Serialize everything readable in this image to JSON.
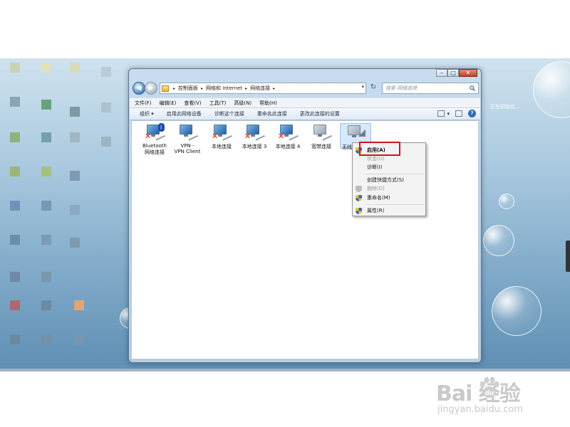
{
  "window": {
    "controls": {
      "minimize": "–",
      "maximize": "□",
      "close": "✕"
    }
  },
  "address": {
    "back_icon": "left-arrow-icon",
    "forward_icon": "right-arrow-icon",
    "crumbs": [
      "控制面板",
      "网络和 Internet",
      "网络连接"
    ],
    "search_placeholder": "搜索 网络连接",
    "refresh_glyph": "↻"
  },
  "menu": [
    "文件(F)",
    "编辑(E)",
    "查看(V)",
    "工具(T)",
    "高级(N)",
    "帮助(H)"
  ],
  "toolbar": {
    "organize": "组织 ▾",
    "enable_device": "启用此网络设备",
    "diagnose": "诊断这个连接",
    "rename": "重命名此连接",
    "change_settings": "更改此连接的设置",
    "help": "?"
  },
  "connections": [
    {
      "line1": "Bluetooth",
      "line2": "网络连接",
      "disabled": true,
      "badge": "bluetooth"
    },
    {
      "line1": "VPN -",
      "line2": "VPN Client",
      "disabled": false,
      "badge": ""
    },
    {
      "line1": "本地连接",
      "line2": "",
      "disabled": true,
      "badge": ""
    },
    {
      "line1": "本地连接 3",
      "line2": "",
      "disabled": true,
      "badge": ""
    },
    {
      "line1": "本地连接 4",
      "line2": "",
      "disabled": true,
      "badge": ""
    },
    {
      "line1": "宽带连接",
      "line2": "",
      "disabled": false,
      "badge": "grey"
    },
    {
      "line1": "无线",
      "line2": "",
      "disabled": false,
      "badge": "wireless",
      "selected": true
    }
  ],
  "context_menu": [
    {
      "label": "启用(A)",
      "enabled": true,
      "icon": "shield"
    },
    {
      "label": "状态(U)",
      "enabled": false,
      "icon": ""
    },
    {
      "label": "诊断(I)",
      "enabled": true,
      "icon": ""
    },
    {
      "label": "创建快捷方式(S)",
      "enabled": true,
      "icon": ""
    },
    {
      "label": "删除(D)",
      "enabled": false,
      "icon": "shield"
    },
    {
      "label": "重命名(M)",
      "enabled": true,
      "icon": "shield"
    },
    {
      "label": "属性(R)",
      "enabled": true,
      "icon": "shield"
    }
  ],
  "desktop": {
    "gadget_text": "正在初始化..."
  },
  "watermark": {
    "logo_text": "Bai  经验",
    "url": "jingyan.baidu.com"
  },
  "colors": {
    "highlight_box": "#d2141e",
    "disabled_x": "#d01a0a"
  }
}
